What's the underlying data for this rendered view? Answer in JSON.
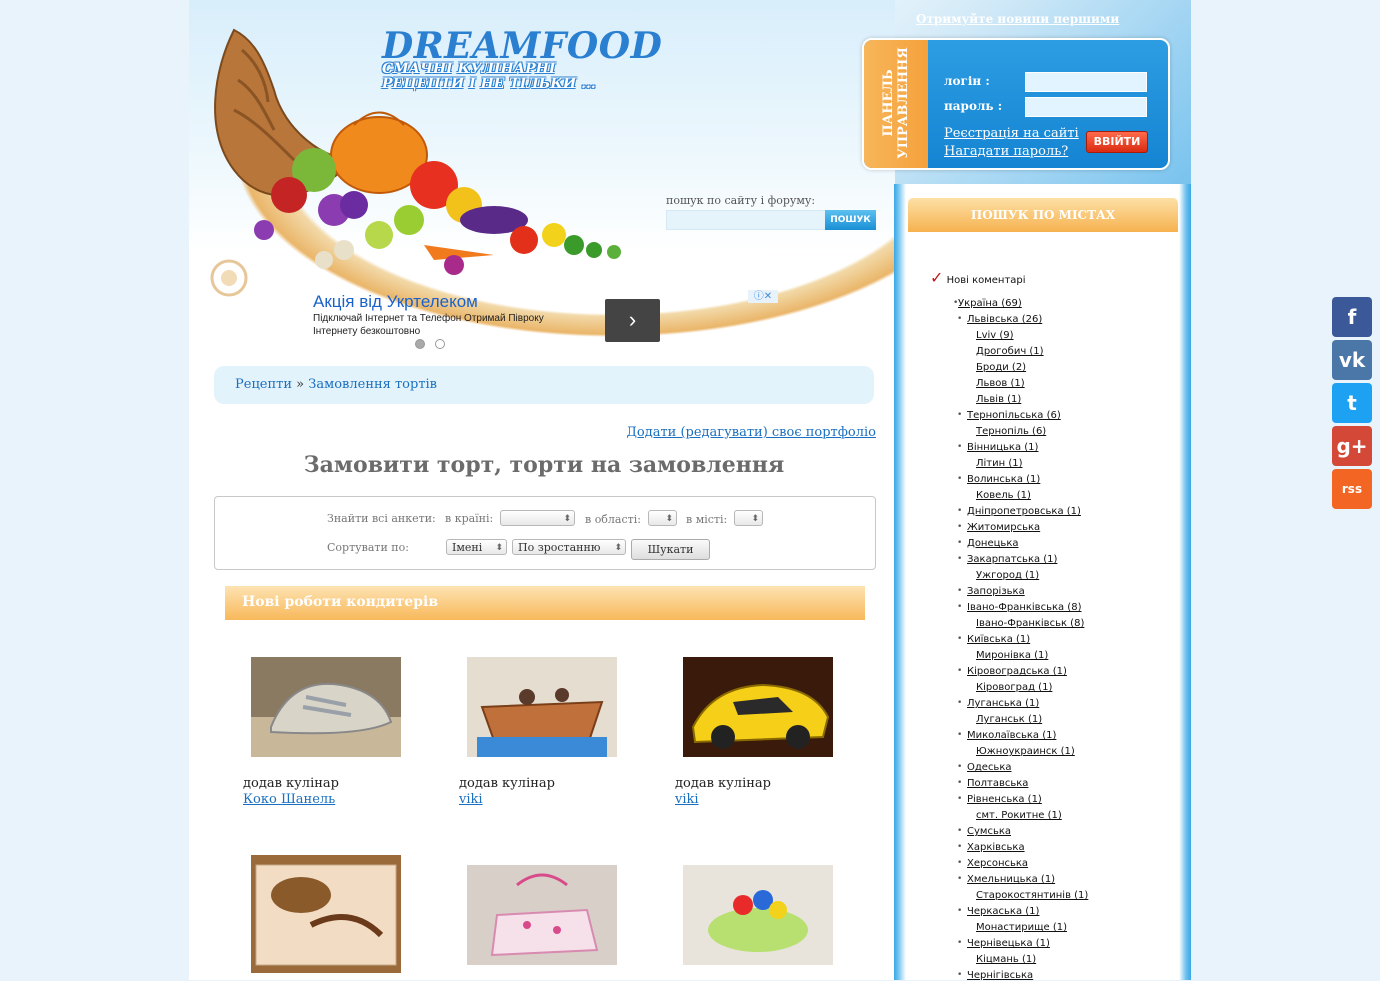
{
  "header": {
    "logo_title": "DREAMFOOD",
    "logo_subtitle": "СМАЧНІ КУЛІНАРНІ РЕЦЕПТИ І НЕ ТІЛЬКИ ...",
    "news_link": "Отримуйте новини першими"
  },
  "login_panel": {
    "tab_label": "ПАНЕЛЬ УПРАВЛЕННЯ",
    "login_label": "логін :",
    "password_label": "пароль :",
    "register_link": "Реєстрація на сайті",
    "remind_link": "Нагадати пароль?",
    "enter_button": "ВВІЙТИ"
  },
  "search": {
    "label": "пошук по сайту і форуму:",
    "button": "ПОШУК"
  },
  "ad": {
    "title": "Акція від Укртелеком",
    "text": "Підключай Інтернет та Телефон Отримай Півроку Інтернету безкоштовно",
    "arrow": "›",
    "info": "ⓘ✕"
  },
  "breadcrumb": {
    "root": "Рецепти",
    "separator": "»",
    "current": "Замовлення тортів"
  },
  "portfolio_link": "Додати (редагувати) своє портфоліо",
  "page_title": "Замовити торт, торти на замовлення",
  "filter": {
    "find_all": "Знайти всі анкети:",
    "country_label": "в країні:",
    "region_label": "в області:",
    "city_label": "в місті:",
    "sort_label": "Сортувати по:",
    "sort_field": "Імені",
    "sort_order": "По зростанню",
    "search_button": "Шукати"
  },
  "new_works": {
    "title": "Нові роботи кондитерів",
    "cards": [
      {
        "added": "додав кулінар",
        "author": "Коко Шанель",
        "image": "sneaker-cake"
      },
      {
        "added": "додав кулінар",
        "author": "viki",
        "image": "pirate-ship-cake"
      },
      {
        "added": "додав кулінар",
        "author": "viki",
        "image": "yellow-car-cake"
      },
      {
        "image": "cowboy-cake"
      },
      {
        "image": "pink-box-cake"
      },
      {
        "image": "flower-cake"
      }
    ]
  },
  "sidebar": {
    "title": "ПОШУК ПО МІСТАХ",
    "new_comments": "Нові коментарі",
    "regions": [
      {
        "name": "Україна (69)",
        "level": 0
      },
      {
        "name": "Львівська (26)",
        "level": 1
      },
      {
        "name": "Lviv (9)",
        "level": 2
      },
      {
        "name": "Дрогобич (1)",
        "level": 2
      },
      {
        "name": "Броди (2)",
        "level": 2
      },
      {
        "name": "Львов (1)",
        "level": 2
      },
      {
        "name": "Львів (1)",
        "level": 2
      },
      {
        "name": "Тернопільська (6)",
        "level": 1
      },
      {
        "name": "Тернопіль (6)",
        "level": 2
      },
      {
        "name": "Вінницька (1)",
        "level": 1
      },
      {
        "name": "Літин (1)",
        "level": 2
      },
      {
        "name": "Волинська (1)",
        "level": 1
      },
      {
        "name": "Ковель (1)",
        "level": 2
      },
      {
        "name": "Дніпропетровська (1)",
        "level": 1
      },
      {
        "name": "Житомирська",
        "level": 1
      },
      {
        "name": "Донецька",
        "level": 1
      },
      {
        "name": "Закарпатська (1)",
        "level": 1
      },
      {
        "name": "Ужгород (1)",
        "level": 2
      },
      {
        "name": "Запорізька",
        "level": 1
      },
      {
        "name": "Івано-Франківська (8)",
        "level": 1
      },
      {
        "name": "Івано-Франківськ (8)",
        "level": 2
      },
      {
        "name": "Київська (1)",
        "level": 1
      },
      {
        "name": "Миронівка (1)",
        "level": 2
      },
      {
        "name": "Кіровоградська (1)",
        "level": 1
      },
      {
        "name": "Кіровоград (1)",
        "level": 2
      },
      {
        "name": "Луганська (1)",
        "level": 1
      },
      {
        "name": "Луганськ (1)",
        "level": 2
      },
      {
        "name": "Миколаївська (1)",
        "level": 1
      },
      {
        "name": "Южноукраинск (1)",
        "level": 2
      },
      {
        "name": "Одеська",
        "level": 1
      },
      {
        "name": "Полтавська",
        "level": 1
      },
      {
        "name": "Рівненська (1)",
        "level": 1
      },
      {
        "name": "смт. Рокитне (1)",
        "level": 2
      },
      {
        "name": "Сумська",
        "level": 1
      },
      {
        "name": "Харківська",
        "level": 1
      },
      {
        "name": "Херсонська",
        "level": 1
      },
      {
        "name": "Хмельницька (1)",
        "level": 1
      },
      {
        "name": "Старокостянтинів (1)",
        "level": 2
      },
      {
        "name": "Черкаська (1)",
        "level": 1
      },
      {
        "name": "Монастирище (1)",
        "level": 2
      },
      {
        "name": "Чернівецька (1)",
        "level": 1
      },
      {
        "name": "Кіцмань (1)",
        "level": 2
      },
      {
        "name": "Чернігівська",
        "level": 1
      }
    ]
  },
  "social": [
    {
      "name": "facebook",
      "glyph": "f",
      "color": "#3b5998"
    },
    {
      "name": "vk",
      "glyph": "vk",
      "color": "#4a76a8"
    },
    {
      "name": "twitter",
      "glyph": "t",
      "color": "#1da1f2"
    },
    {
      "name": "google-plus",
      "glyph": "g+",
      "color": "#d34836"
    },
    {
      "name": "rss",
      "glyph": "rss",
      "color": "#f26522"
    }
  ]
}
